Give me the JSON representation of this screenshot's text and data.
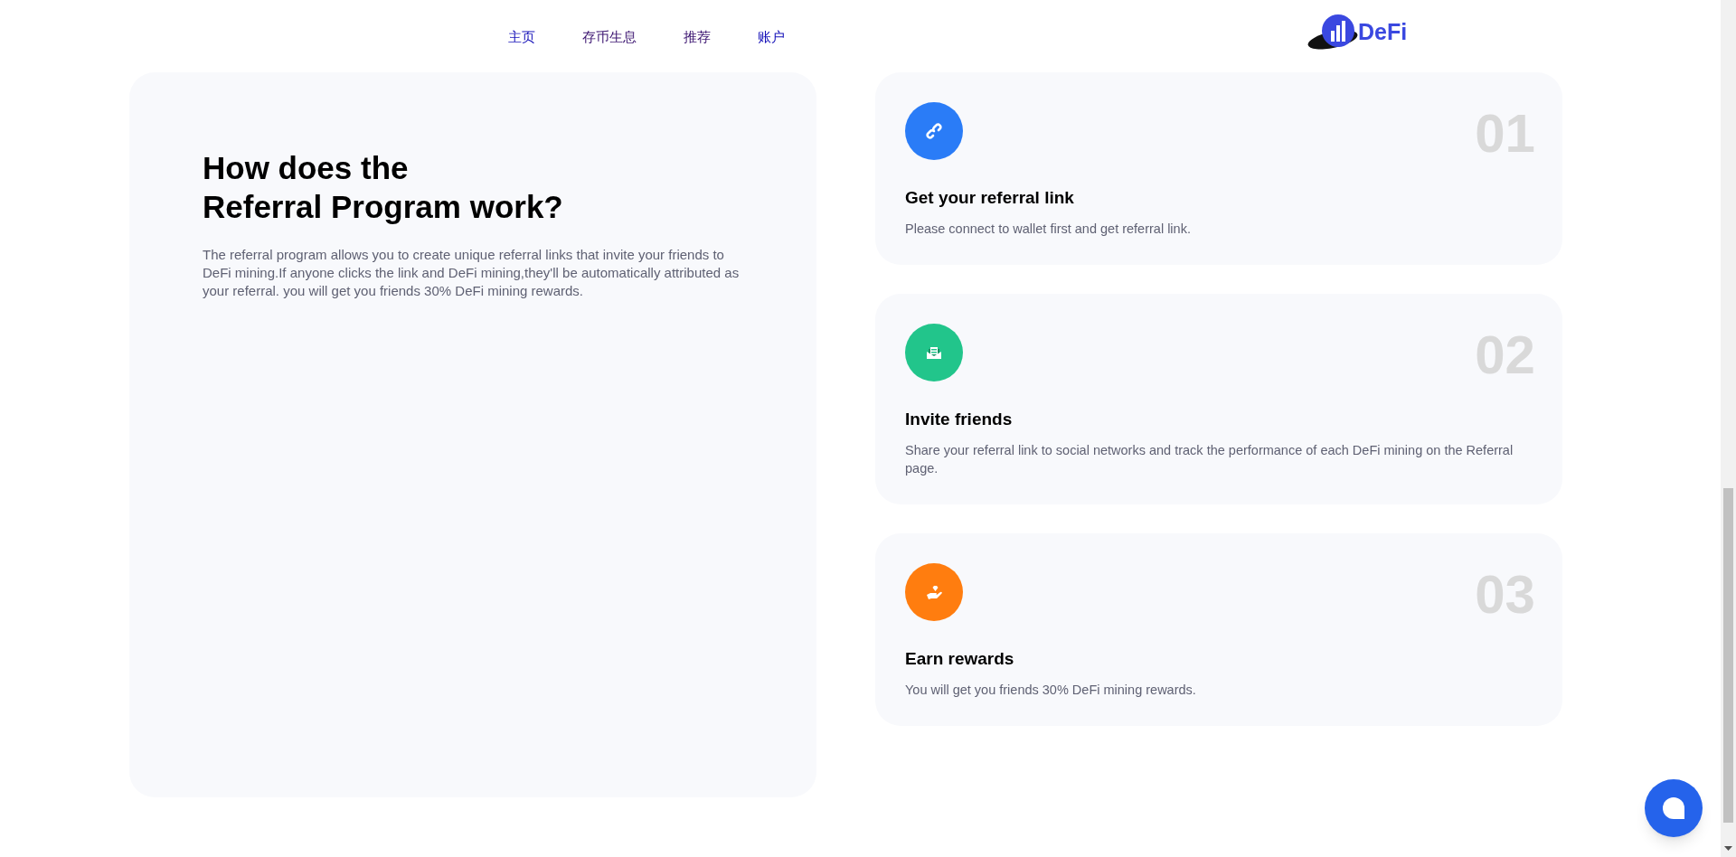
{
  "nav": {
    "items": [
      {
        "label": "主页",
        "visited": false
      },
      {
        "label": "存币生息",
        "visited": true
      },
      {
        "label": "推荐",
        "visited": true
      },
      {
        "label": "账户",
        "visited": false
      }
    ],
    "logo_text": "DeFi"
  },
  "intro": {
    "heading_lines": [
      "How does the",
      "Referral Program work?"
    ],
    "description": "The referral program allows you to create unique referral links that invite your friends to DeFi mining.If anyone clicks the link and DeFi mining,they'll be automatically attributed as your referral. you will get you friends 30% DeFi mining rewards."
  },
  "steps": [
    {
      "kind": "link",
      "color": "#2a7cf7",
      "number": "01",
      "title": "Get your referral link",
      "description": "Please connect to wallet first and get referral link."
    },
    {
      "kind": "mail",
      "color": "#22c58b",
      "number": "02",
      "title": "Invite friends",
      "description": "Share your referral link to social networks and track the performance of each DeFi mining on the Referral page."
    },
    {
      "kind": "reward",
      "color": "#ff7d0f",
      "number": "03",
      "title": "Earn rewards",
      "description": "You will get you friends 30% DeFi mining rewards."
    }
  ]
}
